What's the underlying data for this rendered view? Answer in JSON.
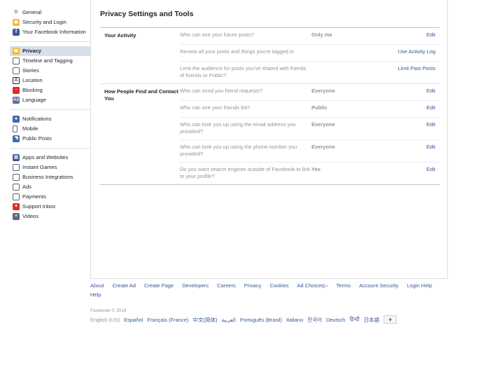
{
  "sidebar": {
    "groups": [
      [
        {
          "label": "General",
          "icon": "gear-icon"
        },
        {
          "label": "Security and Login",
          "icon": "lock-icon"
        },
        {
          "label": "Your Facebook Information",
          "icon": "facebook-icon"
        }
      ],
      [
        {
          "label": "Privacy",
          "icon": "privacy-lock-icon",
          "active": true
        },
        {
          "label": "Timeline and Tagging",
          "icon": "timeline-icon"
        },
        {
          "label": "Stories",
          "icon": "stories-icon"
        },
        {
          "label": "Location",
          "icon": "location-icon"
        },
        {
          "label": "Blocking",
          "icon": "block-icon"
        },
        {
          "label": "Language",
          "icon": "language-icon"
        }
      ],
      [
        {
          "label": "Notifications",
          "icon": "globe-icon"
        },
        {
          "label": "Mobile",
          "icon": "mobile-icon"
        },
        {
          "label": "Public Posts",
          "icon": "rss-icon"
        }
      ],
      [
        {
          "label": "Apps and Websites",
          "icon": "apps-icon"
        },
        {
          "label": "Instant Games",
          "icon": "games-icon"
        },
        {
          "label": "Business Integrations",
          "icon": "business-icon"
        },
        {
          "label": "Ads",
          "icon": "ads-icon"
        },
        {
          "label": "Payments",
          "icon": "card-icon"
        },
        {
          "label": "Support Inbox",
          "icon": "support-icon"
        },
        {
          "label": "Videos",
          "icon": "film-icon"
        }
      ]
    ]
  },
  "main": {
    "title": "Privacy Settings and Tools",
    "sections": [
      {
        "title": "Your Activity",
        "rows": [
          {
            "question": "Who can see your future posts?",
            "value": "Only me",
            "action": "Edit"
          },
          {
            "question": "Review all your posts and things you're tagged in",
            "value": "",
            "action": "Use Activity Log"
          },
          {
            "question": "Limit the audience for posts you've shared with friends of friends or Public?",
            "value": "",
            "action": "Limit Past Posts"
          }
        ]
      },
      {
        "title": "How People Find and Contact You",
        "rows": [
          {
            "question": "Who can send you friend requests?",
            "value": "Everyone",
            "action": "Edit"
          },
          {
            "question": "Who can see your friends list?",
            "value": "Public",
            "action": "Edit"
          },
          {
            "question": "Who can look you up using the email address you provided?",
            "value": "Everyone",
            "action": "Edit"
          },
          {
            "question": "Who can look you up using the phone number you provided?",
            "value": "Everyone",
            "action": "Edit"
          },
          {
            "question": "Do you want search engines outside of Facebook to link to your profile?",
            "value": "Yes",
            "action": "Edit"
          }
        ]
      }
    ]
  },
  "footer": {
    "links": [
      "About",
      "Create Ad",
      "Create Page",
      "Developers",
      "Careers",
      "Privacy",
      "Cookies",
      "Ad Choices▷",
      "Terms",
      "Account Security",
      "Login Help",
      "Help"
    ],
    "copyright": "Facebook © 2019",
    "current_language": "English (US)",
    "languages": [
      "Español",
      "Français (France)",
      "中文(简体)",
      "العربية",
      "Português (Brasil)",
      "Italiano",
      "한국어",
      "Deutsch",
      "हिन्दी",
      "日本語"
    ],
    "more_label": "+"
  }
}
